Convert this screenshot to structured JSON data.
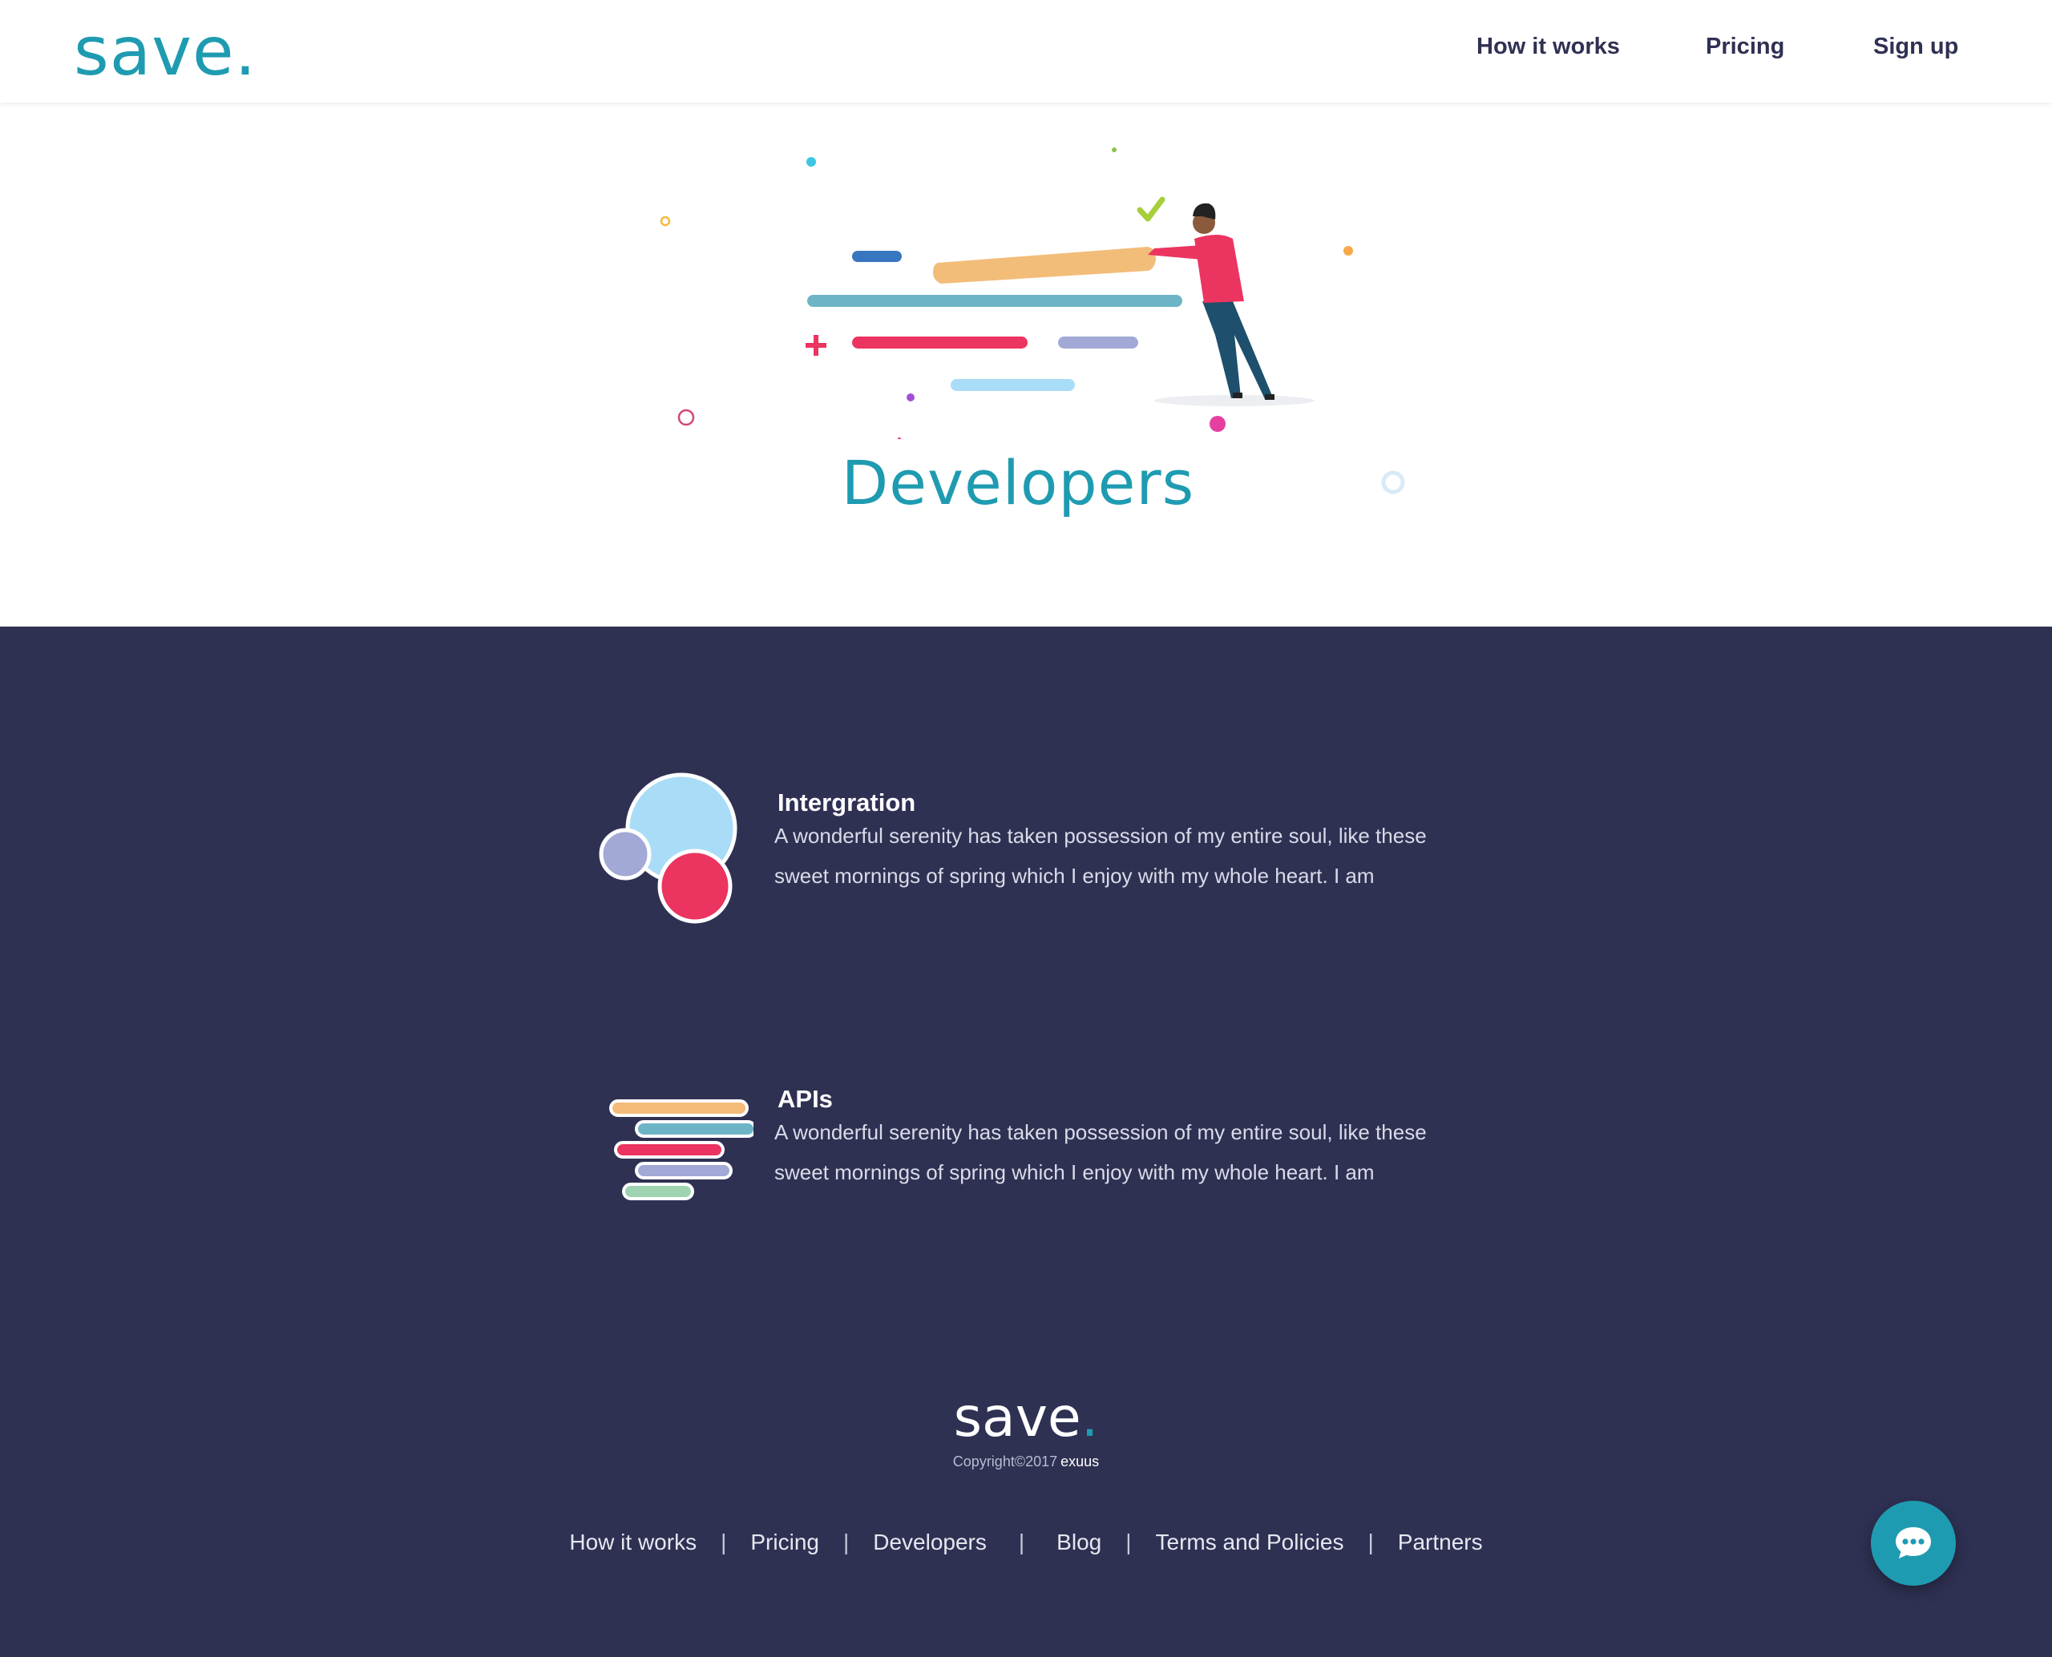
{
  "header": {
    "logo_text": "save",
    "logo_dot": ".",
    "nav": {
      "how_it_works": "How it works",
      "pricing": "Pricing",
      "sign_up": "Sign up"
    }
  },
  "hero": {
    "title": "Developers"
  },
  "features": [
    {
      "title": "Intergration",
      "line1": "A wonderful serenity has taken possession of my entire soul, like these",
      "line2": "sweet mornings of spring which I enjoy with my whole heart. I am"
    },
    {
      "title": "APIs",
      "line1": "A wonderful serenity has taken possession of my entire soul, like these",
      "line2": "sweet mornings of spring which I enjoy with my whole heart. I am"
    }
  ],
  "footer": {
    "logo_text": "save",
    "logo_dot": ".",
    "copyright": "Copyright©2017",
    "brand": "exuus",
    "links": [
      "How it works",
      "Pricing",
      "Developers",
      "Blog",
      "Terms and Policies",
      "Partners"
    ],
    "separator": "|"
  },
  "icons": {
    "chat": "chat-bubble-icon",
    "integration": "circles-icon",
    "apis": "stacked-bars-icon"
  },
  "colors": {
    "brand_teal": "#1f9bb1",
    "dark_navy": "#2f3153",
    "accent_red": "#ec3460",
    "light_blue": "#a9dcf7",
    "lavender": "#a2a9d6",
    "peach": "#f4bb79",
    "teal_bar": "#6db5c6",
    "mint": "#9fd3b1"
  }
}
